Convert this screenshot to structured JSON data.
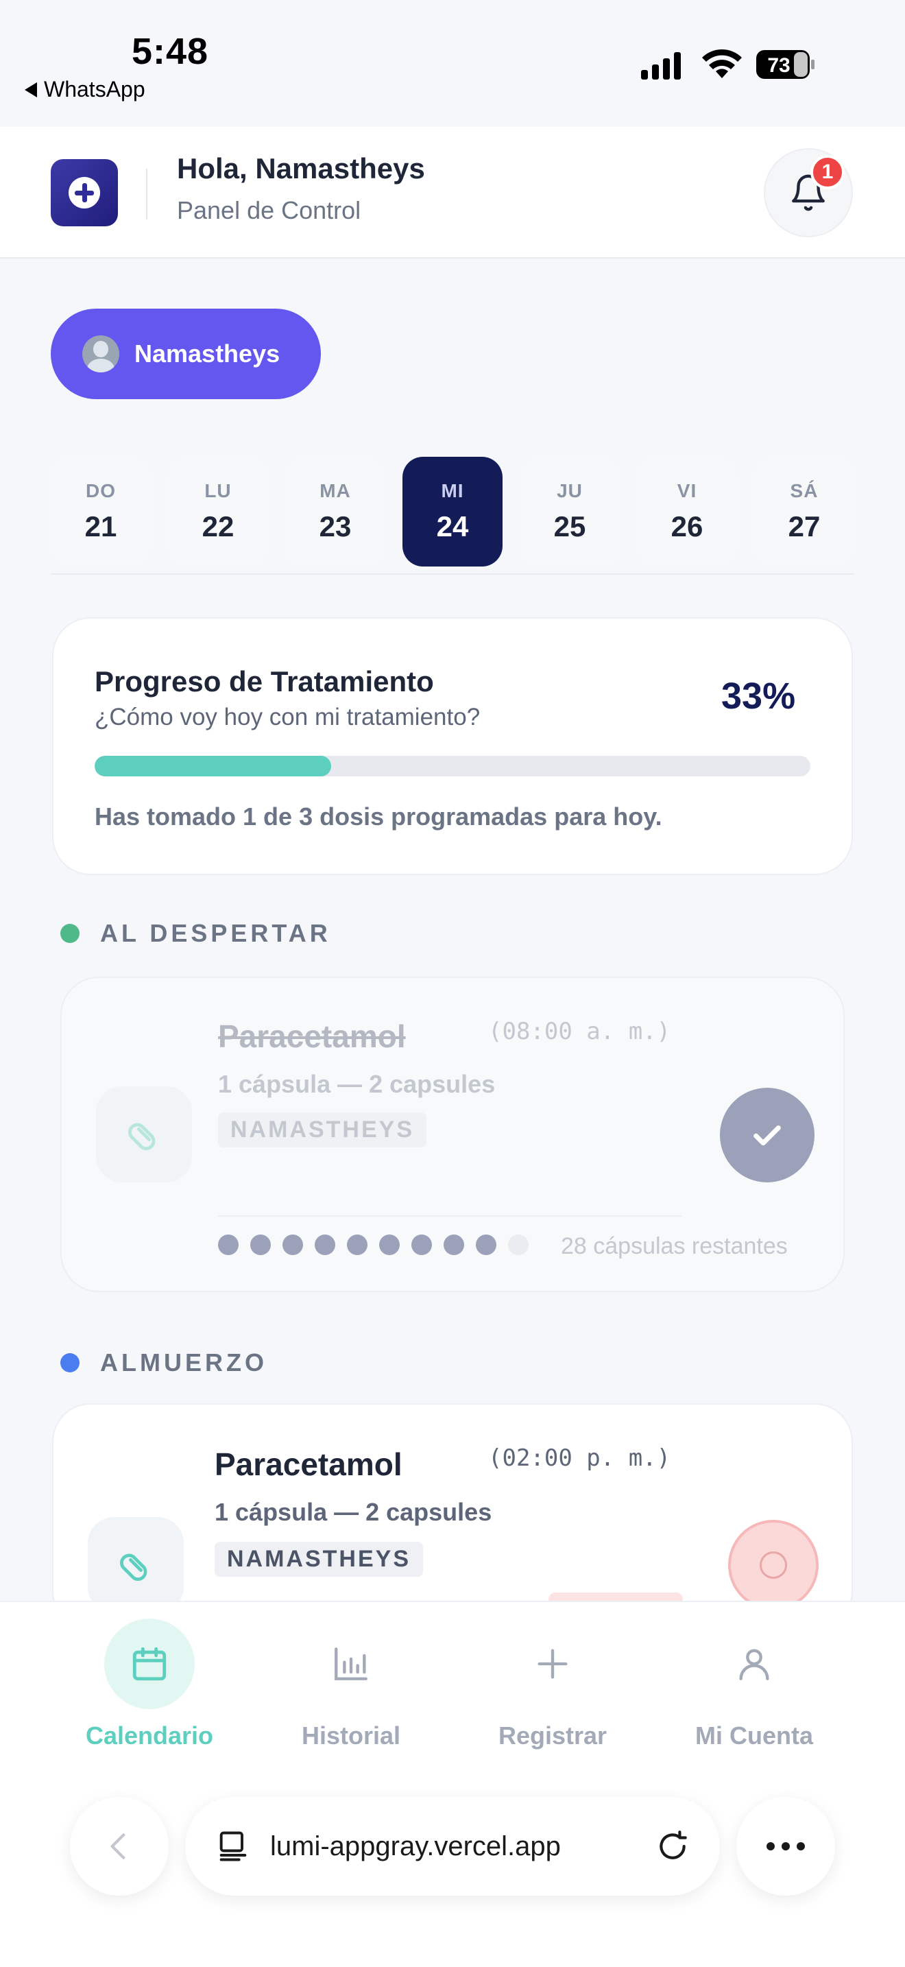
{
  "status_bar": {
    "time": "5:48",
    "back_app": "WhatsApp",
    "battery": "73"
  },
  "header": {
    "greeting": "Hola, Namastheys",
    "subtitle": "Panel de Control",
    "notification_count": "1"
  },
  "profile": {
    "name": "Namastheys"
  },
  "days": [
    {
      "dow": "DO",
      "num": "21"
    },
    {
      "dow": "LU",
      "num": "22"
    },
    {
      "dow": "MA",
      "num": "23"
    },
    {
      "dow": "MI",
      "num": "24",
      "active": true
    },
    {
      "dow": "JU",
      "num": "25"
    },
    {
      "dow": "VI",
      "num": "26"
    },
    {
      "dow": "SÁ",
      "num": "27"
    }
  ],
  "progress": {
    "title": "Progreso de Tratamiento",
    "subtitle": "¿Cómo voy hoy con mi tratamiento?",
    "percent_label": "33%",
    "fraction": 0.33,
    "message": "Has tomado 1 de 3 dosis programadas para hoy."
  },
  "sections": {
    "wake": {
      "label": "AL DESPERTAR",
      "color": "#4fb98a"
    },
    "lunch": {
      "label": "ALMUERZO",
      "color": "#4a7ef0"
    }
  },
  "dose_wake": {
    "name": "Paracetamol",
    "time": "(08:00 a. m.)",
    "dose": "1 cápsula — 2 capsules",
    "tag": "NAMASTHEYS",
    "remaining": "28 cápsulas restantes",
    "capsules_filled": 9,
    "capsules_total": 10,
    "status": "taken"
  },
  "dose_lunch": {
    "name": "Paracetamol",
    "time": "(02:00 p. m.)",
    "dose": "1 cápsula — 2 capsules",
    "tag": "NAMASTHEYS",
    "status": "pending"
  },
  "nav": [
    {
      "label": "Calendario",
      "icon": "calendar-icon",
      "active": true
    },
    {
      "label": "Historial",
      "icon": "bar-chart-icon"
    },
    {
      "label": "Registrar",
      "icon": "plus-icon"
    },
    {
      "label": "Mi Cuenta",
      "icon": "user-icon"
    }
  ],
  "browser": {
    "url": "lumi-appgray.vercel.app"
  },
  "colors": {
    "primary": "#6357f0",
    "navy": "#141c58",
    "teal": "#5ccfbf",
    "alert": "#ef4444"
  }
}
